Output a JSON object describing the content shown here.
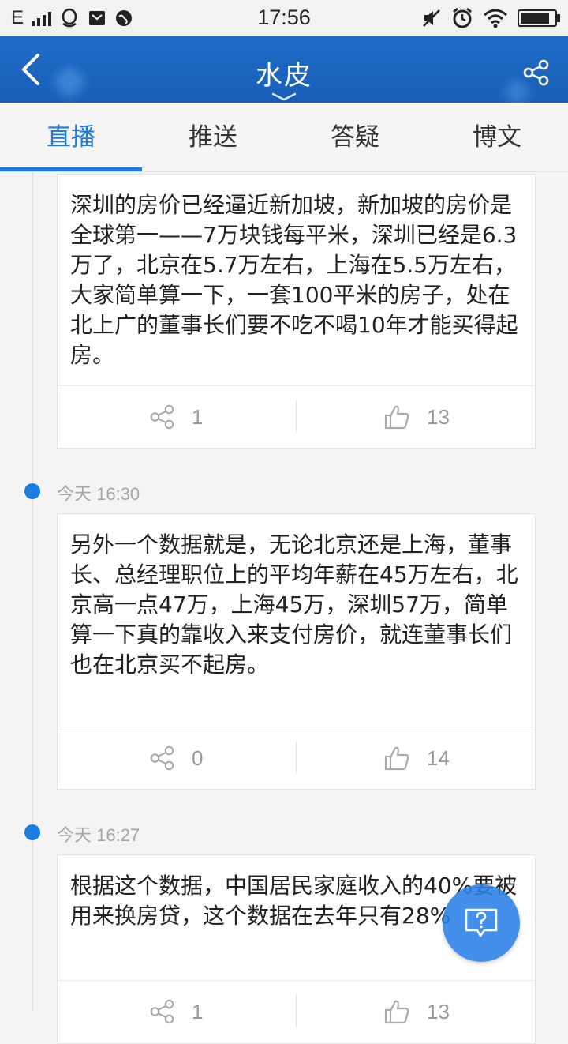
{
  "status_bar": {
    "network": "E",
    "time": "17:56"
  },
  "nav": {
    "title": "水皮"
  },
  "tabs": [
    {
      "label": "直播"
    },
    {
      "label": "推送"
    },
    {
      "label": "答疑"
    },
    {
      "label": "博文"
    }
  ],
  "active_tab": "直播",
  "feed": [
    {
      "time": "",
      "text": "深圳的房价已经逼近新加坡，新加坡的房价是全球第一——7万块钱每平米，深圳已经是6.3万了，北京在5.7万左右，上海在5.5万左右，大家简单算一下，一套100平米的房子，处在北上广的董事长们要不吃不喝10年才能买得起房。",
      "shares": "1",
      "likes": "13"
    },
    {
      "time": "今天 16:30",
      "text": "另外一个数据就是，无论北京还是上海，董事长、总经理职位上的平均年薪在45万左右，北京高一点47万，上海45万，深圳57万，简单算一下真的靠收入来支付房价，就连董事长们也在北京买不起房。",
      "shares": "0",
      "likes": "14"
    },
    {
      "time": "今天 16:27",
      "text": "根据这个数据，中国居民家庭收入的40%要被用来换房贷，这个数据在去年只有28%",
      "shares": "1",
      "likes": "13"
    }
  ],
  "colors": {
    "accent": "#1f7bdb",
    "navbar": "#1b65bf"
  }
}
